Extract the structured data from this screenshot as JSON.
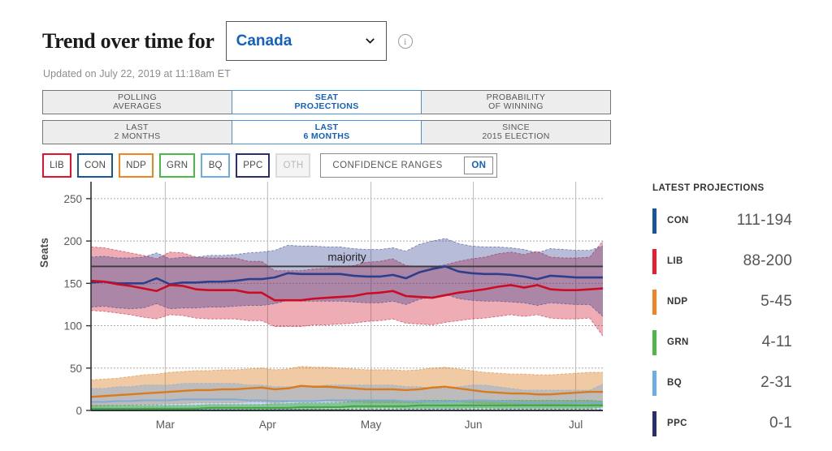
{
  "header": {
    "title": "Trend over time for",
    "region_selected": "Canada",
    "region_options": [
      "Canada"
    ],
    "info_icon": "info-icon",
    "chevron_icon": "chevron-down-icon",
    "updated_text": "Updated on July 22, 2019 at 11:18am ET"
  },
  "tabs_primary": [
    {
      "line1": "POLLING",
      "line2": "AVERAGES",
      "active": false
    },
    {
      "line1": "SEAT",
      "line2": "PROJECTIONS",
      "active": true
    },
    {
      "line1": "PROBABILITY",
      "line2": "OF WINNING",
      "active": false
    }
  ],
  "tabs_secondary": [
    {
      "line1": "LAST",
      "line2": "2 MONTHS",
      "active": false
    },
    {
      "line1": "LAST",
      "line2": "6 MONTHS",
      "active": true
    },
    {
      "line1": "SINCE",
      "line2": "2015 ELECTION",
      "active": false
    }
  ],
  "party_filters": [
    {
      "label": "LIB",
      "color": "#e8112d",
      "enabled": true
    },
    {
      "label": "CON",
      "color": "#15569e",
      "enabled": true
    },
    {
      "label": "NDP",
      "color": "#f58220",
      "enabled": true
    },
    {
      "label": "GRN",
      "color": "#4cb847",
      "enabled": true
    },
    {
      "label": "BQ",
      "color": "#6badea",
      "enabled": true
    },
    {
      "label": "PPC",
      "color": "#2b2e6e",
      "enabled": true
    },
    {
      "label": "OTH",
      "color": "#dcdcdc",
      "enabled": false
    }
  ],
  "confidence": {
    "label": "CONFIDENCE RANGES",
    "toggle_value": "ON"
  },
  "side_panel": {
    "title": "LATEST PROJECTIONS",
    "rows": [
      {
        "party": "CON",
        "range": "111-194",
        "color": "#15569e"
      },
      {
        "party": "LIB",
        "range": "88-200",
        "color": "#ed1b2e"
      },
      {
        "party": "NDP",
        "range": "5-45",
        "color": "#f58220"
      },
      {
        "party": "GRN",
        "range": "4-11",
        "color": "#4cb847"
      },
      {
        "party": "BQ",
        "range": "2-31",
        "color": "#6badea"
      },
      {
        "party": "PPC",
        "range": "0-1",
        "color": "#2b2e6e"
      }
    ]
  },
  "chart_data": {
    "type": "line",
    "title": "",
    "xlabel": "",
    "ylabel": "Seats",
    "ylim": [
      0,
      270
    ],
    "yticks": [
      0,
      50,
      100,
      150,
      200,
      250
    ],
    "grid": true,
    "legend_position": "right-panel",
    "annotations": [
      {
        "text": "majority",
        "type": "hline",
        "value": 170
      }
    ],
    "x_tick_labels": [
      "Mar",
      "Apr",
      "May",
      "Jun",
      "Jul"
    ],
    "x_tick_positions": [
      0.145,
      0.345,
      0.547,
      0.747,
      0.947
    ],
    "x_index_count": 40,
    "series": [
      {
        "name": "CON",
        "color": "#2b3f8c",
        "values": [
          151,
          152,
          150,
          150,
          150,
          156,
          149,
          151,
          151,
          152,
          152,
          153,
          155,
          155,
          157,
          162,
          161,
          161,
          161,
          161,
          159,
          158,
          158,
          160,
          156,
          163,
          167,
          170,
          164,
          162,
          161,
          161,
          160,
          158,
          155,
          159,
          158,
          157,
          157,
          157
        ],
        "band_low": [
          122,
          123,
          121,
          120,
          121,
          126,
          120,
          121,
          121,
          122,
          122,
          123,
          124,
          124,
          126,
          130,
          129,
          129,
          129,
          129,
          128,
          127,
          127,
          129,
          125,
          131,
          134,
          137,
          132,
          130,
          129,
          129,
          128,
          127,
          124,
          127,
          126,
          125,
          125,
          111
        ],
        "band_high": [
          181,
          182,
          180,
          180,
          181,
          186,
          179,
          181,
          181,
          183,
          183,
          184,
          186,
          187,
          189,
          195,
          194,
          194,
          193,
          193,
          191,
          190,
          190,
          192,
          188,
          196,
          200,
          203,
          197,
          194,
          193,
          193,
          192,
          190,
          186,
          191,
          190,
          189,
          189,
          194
        ]
      },
      {
        "name": "LIB",
        "color": "#cc0b24",
        "values": [
          153,
          152,
          149,
          147,
          144,
          141,
          148,
          147,
          143,
          142,
          142,
          142,
          139,
          139,
          130,
          130,
          130,
          132,
          133,
          134,
          135,
          138,
          139,
          141,
          135,
          134,
          133,
          136,
          139,
          141,
          143,
          146,
          148,
          145,
          148,
          143,
          142,
          142,
          143,
          144
        ],
        "band_low": [
          118,
          117,
          115,
          113,
          110,
          108,
          113,
          112,
          109,
          108,
          108,
          108,
          106,
          106,
          99,
          99,
          99,
          101,
          101,
          102,
          103,
          105,
          106,
          108,
          103,
          102,
          101,
          104,
          106,
          108,
          109,
          111,
          113,
          111,
          113,
          109,
          108,
          108,
          109,
          88
        ],
        "band_high": [
          193,
          192,
          189,
          186,
          183,
          179,
          187,
          186,
          181,
          180,
          180,
          180,
          176,
          176,
          165,
          165,
          165,
          167,
          168,
          170,
          171,
          175,
          176,
          179,
          171,
          170,
          169,
          172,
          176,
          179,
          181,
          185,
          187,
          184,
          188,
          181,
          180,
          180,
          181,
          200
        ]
      },
      {
        "name": "NDP",
        "color": "#d97b1d",
        "values": [
          16,
          17,
          18,
          19,
          20,
          21,
          22,
          23,
          24,
          24,
          25,
          25,
          26,
          27,
          25,
          26,
          29,
          28,
          28,
          27,
          26,
          25,
          25,
          25,
          24,
          25,
          27,
          28,
          26,
          24,
          22,
          21,
          20,
          20,
          19,
          19,
          20,
          21,
          22,
          22
        ],
        "band_low": [
          5,
          5,
          6,
          6,
          7,
          7,
          8,
          8,
          9,
          9,
          9,
          9,
          10,
          10,
          9,
          10,
          11,
          11,
          11,
          10,
          10,
          9,
          9,
          9,
          9,
          9,
          10,
          11,
          10,
          9,
          8,
          8,
          7,
          7,
          7,
          7,
          7,
          8,
          8,
          5
        ],
        "band_high": [
          36,
          37,
          38,
          40,
          42,
          43,
          45,
          46,
          47,
          47,
          48,
          48,
          49,
          50,
          48,
          49,
          52,
          51,
          51,
          50,
          49,
          48,
          48,
          48,
          47,
          48,
          50,
          51,
          49,
          47,
          45,
          44,
          43,
          43,
          42,
          42,
          43,
          44,
          45,
          45
        ]
      },
      {
        "name": "BQ",
        "color": "#7fa9d6",
        "values": [
          10,
          10,
          11,
          11,
          12,
          12,
          12,
          13,
          13,
          13,
          13,
          13,
          12,
          12,
          11,
          11,
          11,
          11,
          12,
          12,
          12,
          12,
          12,
          12,
          11,
          11,
          10,
          10,
          11,
          12,
          12,
          11,
          10,
          9,
          9,
          9,
          9,
          9,
          9,
          9
        ],
        "band_low": [
          2,
          2,
          2,
          2,
          3,
          3,
          3,
          3,
          3,
          3,
          3,
          3,
          3,
          3,
          2,
          2,
          2,
          2,
          3,
          3,
          3,
          3,
          3,
          3,
          2,
          2,
          2,
          2,
          2,
          3,
          3,
          2,
          2,
          2,
          2,
          2,
          2,
          2,
          2,
          2
        ],
        "band_high": [
          26,
          26,
          28,
          28,
          30,
          30,
          30,
          32,
          32,
          32,
          32,
          32,
          30,
          30,
          28,
          28,
          28,
          28,
          30,
          30,
          30,
          30,
          30,
          30,
          28,
          28,
          26,
          26,
          28,
          30,
          30,
          28,
          26,
          24,
          24,
          24,
          24,
          24,
          24,
          31
        ]
      },
      {
        "name": "GRN",
        "color": "#3da83a",
        "values": [
          2,
          2,
          2,
          2,
          2,
          2,
          2,
          2,
          2,
          3,
          3,
          3,
          3,
          3,
          3,
          3,
          4,
          4,
          4,
          4,
          5,
          5,
          5,
          5,
          5,
          6,
          6,
          6,
          6,
          6,
          6,
          6,
          6,
          6,
          6,
          6,
          6,
          6,
          6,
          6
        ],
        "band_low": [
          0,
          0,
          0,
          0,
          0,
          0,
          0,
          0,
          0,
          1,
          1,
          1,
          1,
          1,
          1,
          1,
          1,
          1,
          1,
          1,
          2,
          2,
          2,
          2,
          2,
          2,
          2,
          2,
          2,
          2,
          2,
          2,
          2,
          2,
          2,
          2,
          2,
          2,
          2,
          4
        ],
        "band_high": [
          6,
          6,
          6,
          6,
          6,
          6,
          6,
          6,
          6,
          7,
          7,
          7,
          7,
          7,
          8,
          8,
          9,
          9,
          9,
          9,
          11,
          11,
          11,
          11,
          11,
          12,
          12,
          12,
          12,
          12,
          12,
          12,
          12,
          12,
          12,
          12,
          12,
          12,
          12,
          11
        ]
      },
      {
        "name": "PPC",
        "color": "#2b2e6e",
        "values": [
          0,
          0,
          0,
          0,
          0,
          0,
          0,
          0,
          0,
          0,
          0,
          0,
          0,
          0,
          0,
          0,
          0,
          0,
          0,
          0,
          0,
          0,
          0,
          0,
          0,
          0,
          0,
          0,
          0,
          0,
          0,
          0,
          0,
          0,
          0,
          0,
          0,
          0,
          0,
          0
        ],
        "band_low": [
          0,
          0,
          0,
          0,
          0,
          0,
          0,
          0,
          0,
          0,
          0,
          0,
          0,
          0,
          0,
          0,
          0,
          0,
          0,
          0,
          0,
          0,
          0,
          0,
          0,
          0,
          0,
          0,
          0,
          0,
          0,
          0,
          0,
          0,
          0,
          0,
          0,
          0,
          0,
          0
        ],
        "band_high": [
          1,
          1,
          1,
          1,
          1,
          1,
          1,
          1,
          1,
          1,
          1,
          1,
          1,
          1,
          1,
          1,
          1,
          1,
          1,
          1,
          1,
          1,
          1,
          1,
          1,
          1,
          1,
          1,
          1,
          1,
          1,
          1,
          1,
          1,
          1,
          1,
          1,
          1,
          1,
          1
        ]
      }
    ]
  }
}
